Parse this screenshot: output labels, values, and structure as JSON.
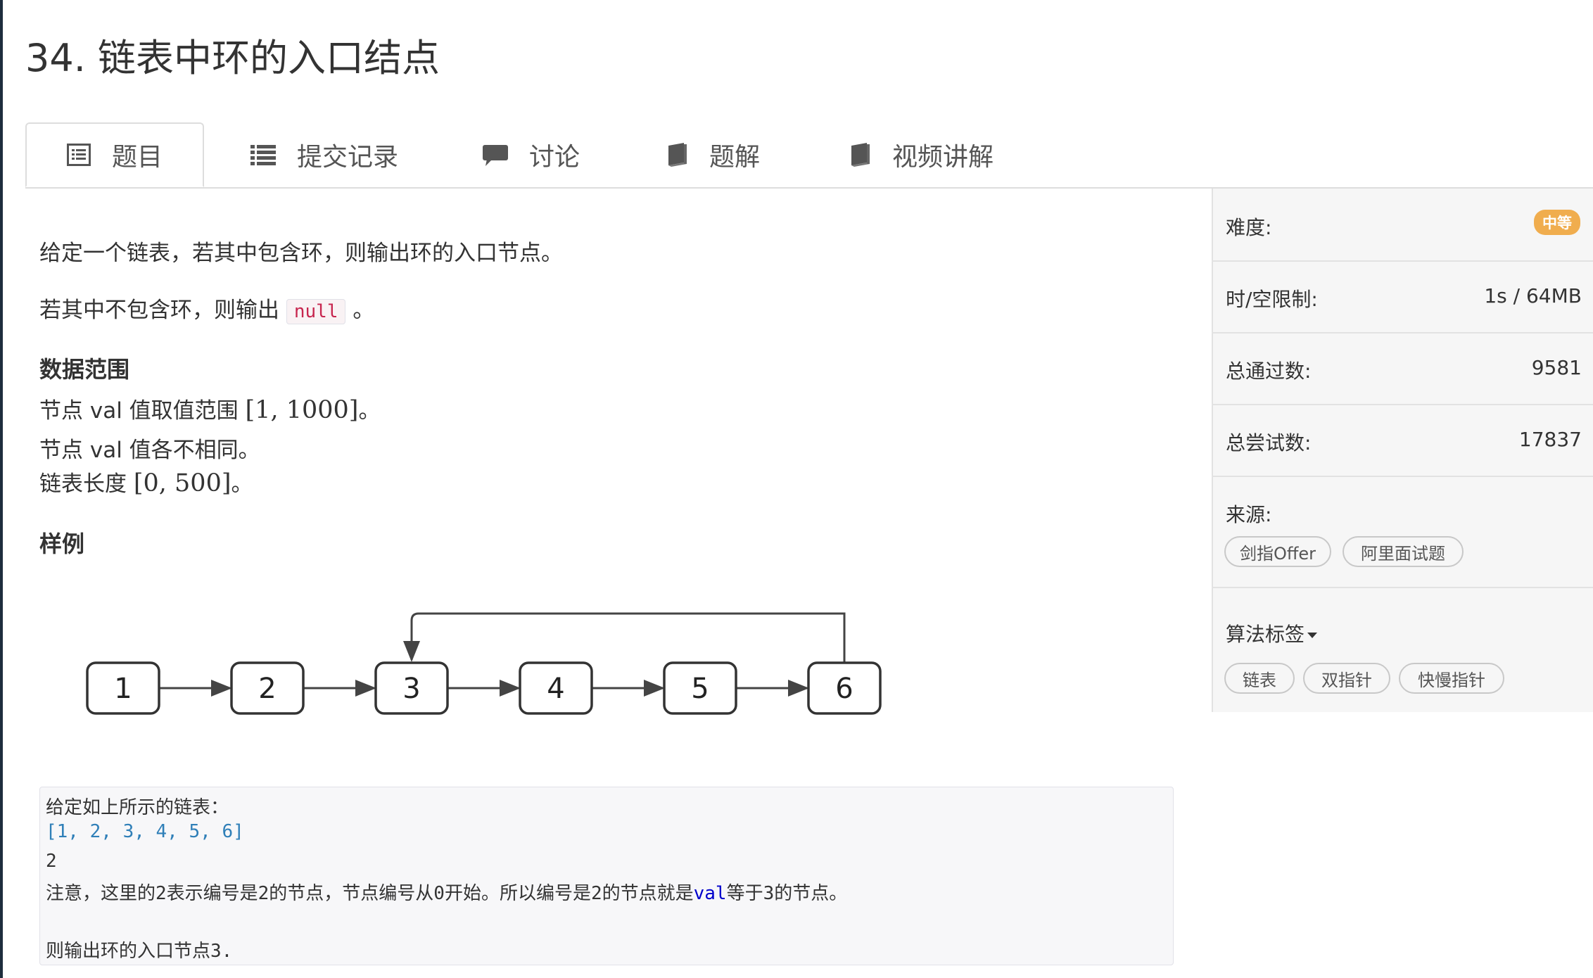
{
  "title": "34. 链表中环的入口结点",
  "tabs": [
    {
      "label": "题目",
      "icon": "list-alt-icon"
    },
    {
      "label": "提交记录",
      "icon": "list-icon"
    },
    {
      "label": "讨论",
      "icon": "comment-icon"
    },
    {
      "label": "题解",
      "icon": "book-icon"
    },
    {
      "label": "视频讲解",
      "icon": "book-icon"
    }
  ],
  "problem": {
    "line1": "给定一个链表，若其中包含环，则输出环的入口节点。",
    "line2_prefix": "若其中不包含环，则输出",
    "line2_code": "null",
    "line2_suffix": "。",
    "range_heading": "数据范围",
    "range1_prefix": "节点 val 值取值范围",
    "range1_math": "[1, 1000]",
    "range1_suffix": "。",
    "range2": "节点 val 值各不相同。",
    "range3_prefix": "链表长度",
    "range3_math": "[0, 500]",
    "range3_suffix": "。",
    "example_heading": "样例"
  },
  "diagram": {
    "nodes": [
      "1",
      "2",
      "3",
      "4",
      "5",
      "6"
    ]
  },
  "example": {
    "line1": "给定如上所示的链表：",
    "line2": "[1, 2, 3, 4, 5, 6]",
    "line3": "2",
    "line4_a": "注意，这里的2表示编号是2的节点，节点编号从0开始。所以编号是2的节点就是",
    "line4_kw": "val",
    "line4_b": "等于3的节点。",
    "line6": "则输出环的入口节点3."
  },
  "sidebar": {
    "difficulty_label": "难度:",
    "difficulty_badge": "中等",
    "limit_label": "时/空限制:",
    "limit_value": "1s / 64MB",
    "passed_label": "总通过数:",
    "passed_value": "9581",
    "tried_label": "总尝试数:",
    "tried_value": "17837",
    "source_label": "来源:",
    "sources": [
      "剑指Offer",
      "阿里面试题"
    ],
    "tags_label": "算法标签",
    "tags": [
      "链表",
      "双指针",
      "快慢指针"
    ]
  },
  "colors": {
    "badge": "#f0ad4e",
    "code_red": "#c7254e",
    "array_blue": "#2f7fb8"
  }
}
